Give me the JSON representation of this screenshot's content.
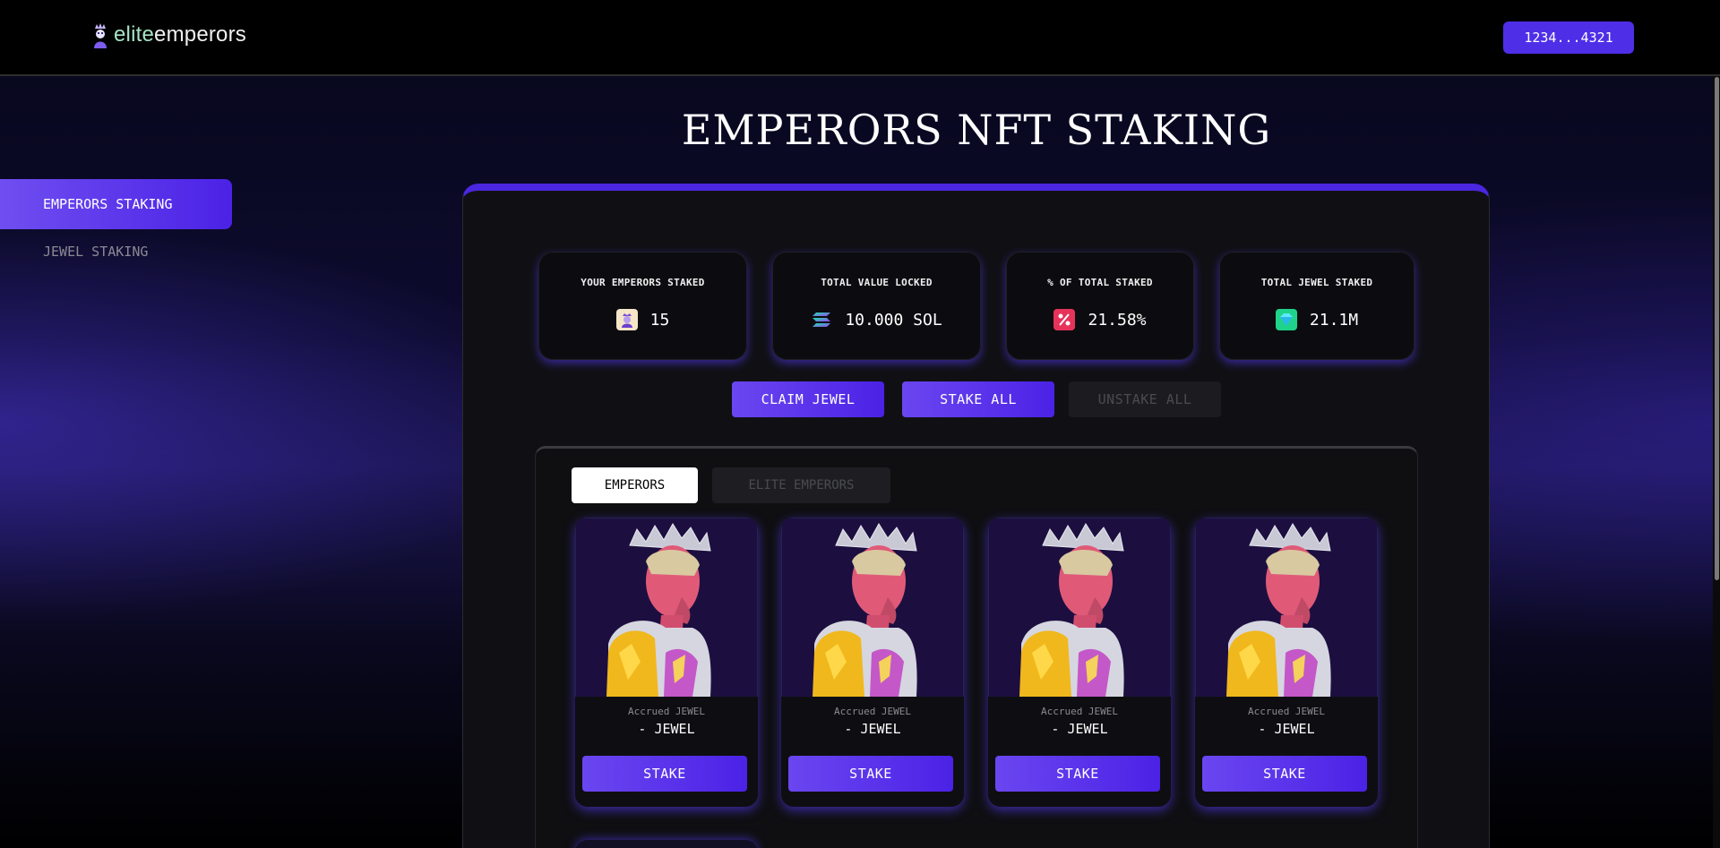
{
  "header": {
    "logo_elite": "elite",
    "logo_emperors": "emperors",
    "wallet_label": "1234...4321"
  },
  "sidebar": {
    "items": [
      {
        "label": "EMPERORS STAKING",
        "active": true
      },
      {
        "label": "JEWEL STAKING",
        "active": false
      }
    ]
  },
  "main": {
    "title": "EMPERORS NFT STAKING",
    "stats": [
      {
        "label": "YOUR EMPERORS STAKED",
        "value": "15",
        "icon": "emperor-icon"
      },
      {
        "label": "TOTAL VALUE LOCKED",
        "value": "10.000 SOL",
        "icon": "solana-icon"
      },
      {
        "label": "% OF TOTAL STAKED",
        "value": "21.58%",
        "icon": "percent-icon"
      },
      {
        "label": "TOTAL JEWEL STAKED",
        "value": "21.1M",
        "icon": "jewel-icon"
      }
    ],
    "actions": {
      "claim": "CLAIM JEWEL",
      "stake_all": "STAKE ALL",
      "unstake_all": "UNSTAKE ALL"
    },
    "tabs": [
      {
        "label": "EMPERORS",
        "active": true
      },
      {
        "label": "ELITE EMPERORS",
        "active": false
      }
    ],
    "cards": [
      {
        "accrued_label": "Accrued JEWEL",
        "accrued_value": "- JEWEL",
        "button": "STAKE"
      },
      {
        "accrued_label": "Accrued JEWEL",
        "accrued_value": "- JEWEL",
        "button": "STAKE"
      },
      {
        "accrued_label": "Accrued JEWEL",
        "accrued_value": "- JEWEL",
        "button": "STAKE"
      },
      {
        "accrued_label": "Accrued JEWEL",
        "accrued_value": "- JEWEL",
        "button": "STAKE"
      }
    ]
  },
  "colors": {
    "accent": "#4b22e6",
    "accent_light": "#6f4ef0",
    "logo_green": "#a6e3c4"
  }
}
